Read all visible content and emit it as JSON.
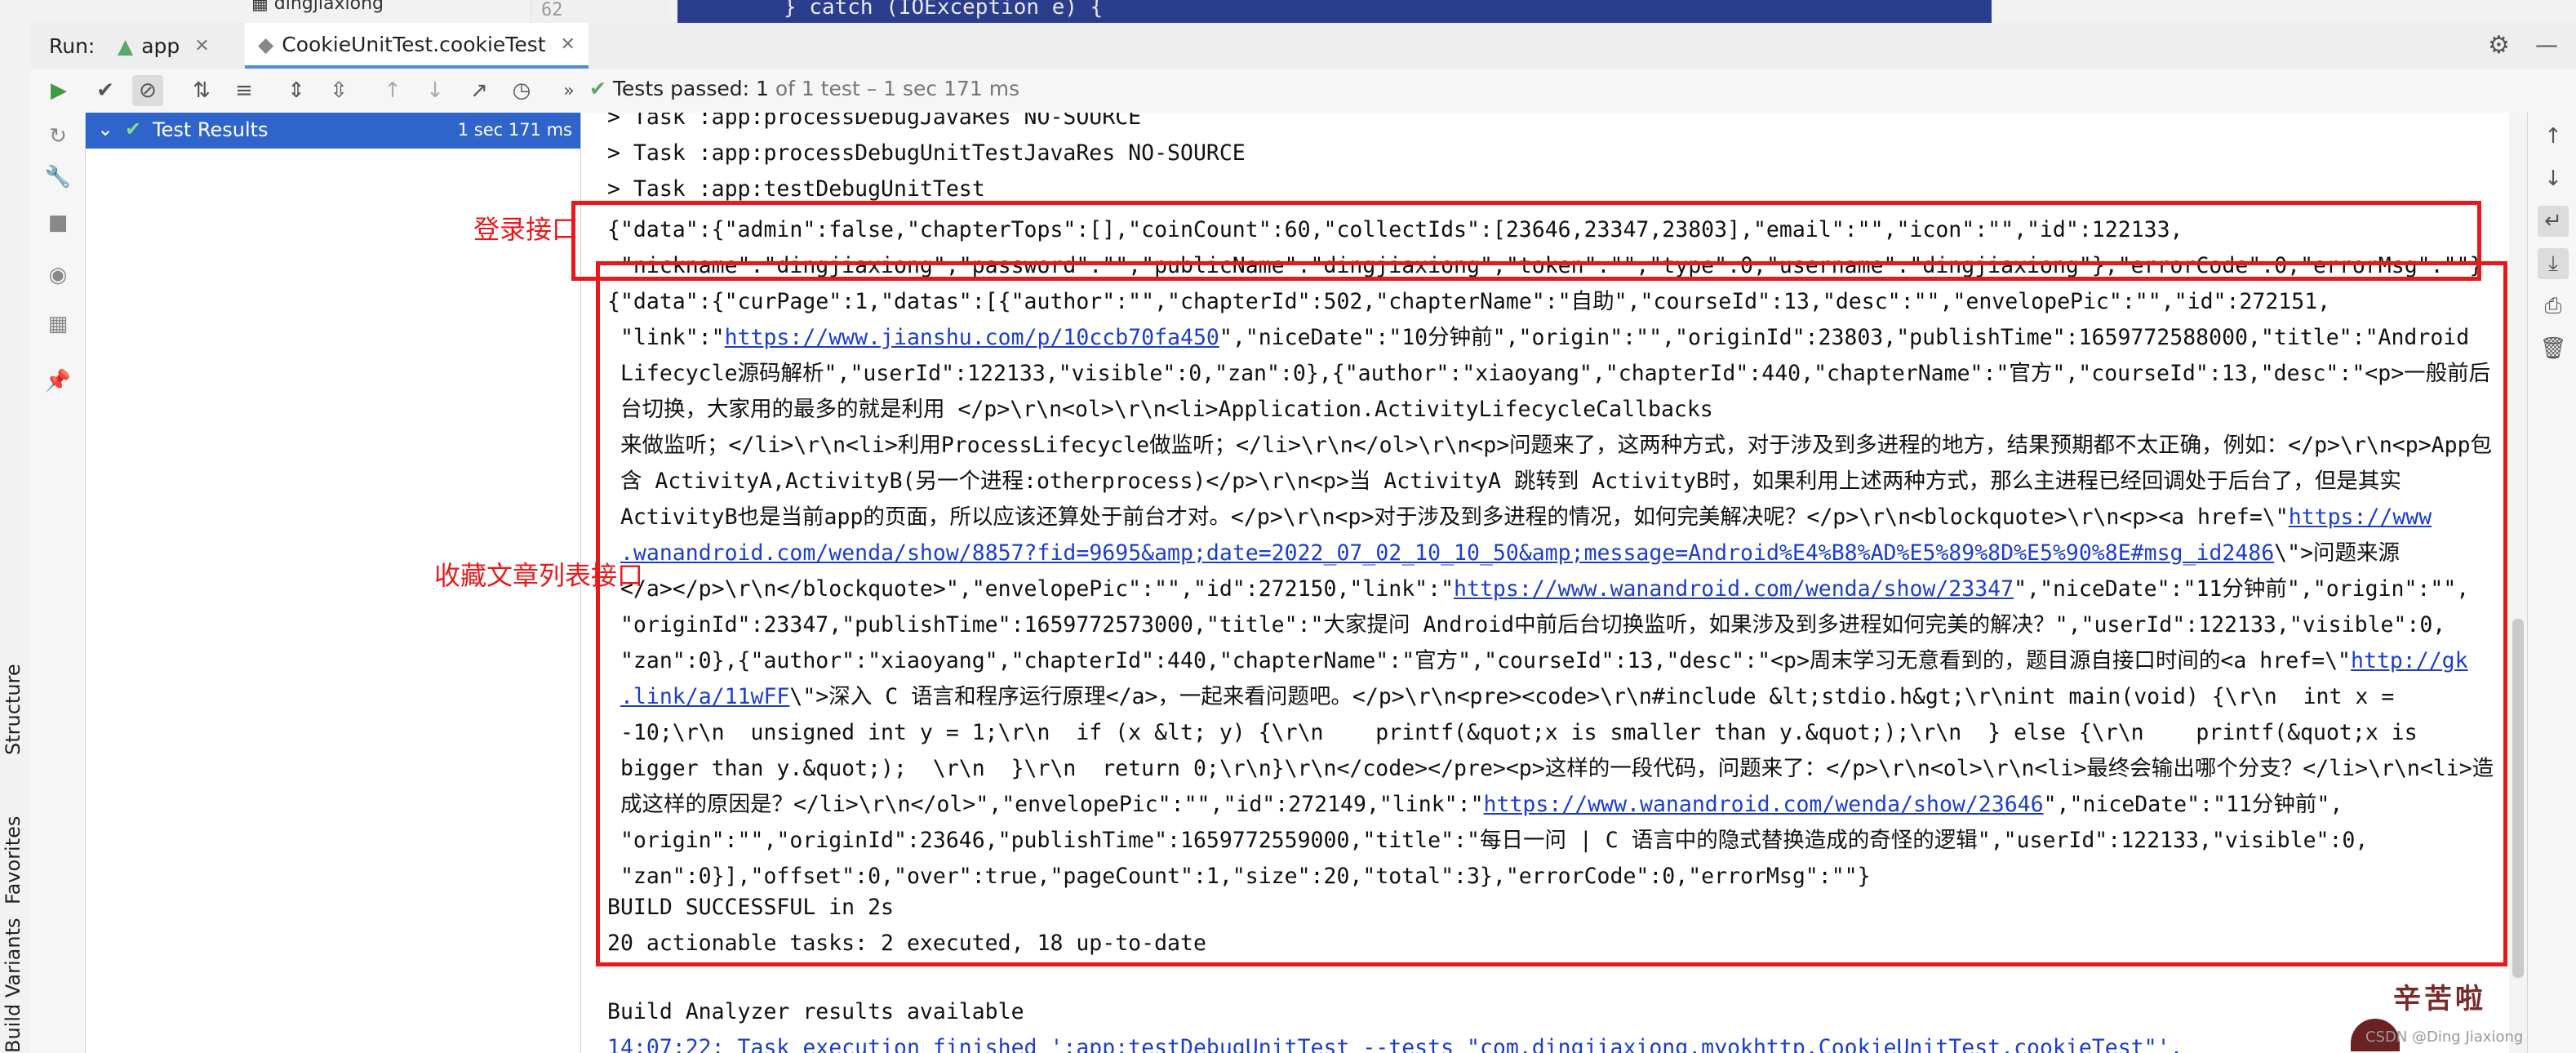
{
  "top_strip": {
    "tree_fragment": "dingjiaxiong",
    "gutter_line": "62",
    "code_fragment": "} catch (IOException e) {"
  },
  "run_bar": {
    "run_label": "Run:",
    "tabs": [
      {
        "label": "app"
      },
      {
        "label": "CookieUnitTest.cookieTest"
      }
    ]
  },
  "toolbar": {
    "status_label": "Tests passed:",
    "status_count": "1",
    "status_detail": "of 1 test – 1 sec 171 ms"
  },
  "tree": {
    "root_label": "Test Results",
    "root_time": "1 sec 171 ms"
  },
  "left_vertical_tabs": [
    "Structure",
    "Favorites",
    "Build Variants"
  ],
  "console": {
    "lines": [
      "> Task :app:processDebugJavaRes NO-SOURCE",
      "> Task :app:processDebugUnitTestJavaRes NO-SOURCE",
      "> Task :app:testDebugUnitTest"
    ],
    "login_json_1": "{\"data\":{\"admin\":false,\"chapterTops\":[],\"coinCount\":60,\"collectIds\":[23646,23347,23803],\"email\":\"\",\"icon\":\"\",\"id\":122133,",
    "login_json_2": " \"nickname\":\"dingjiaxiong\",\"password\":\"\",\"publicName\":\"dingjiaxiong\",\"token\":\"\",\"type\":0,\"username\":\"dingjiaxiong\"},\"errorCode\":0,\"errorMsg\":\"\"}",
    "collect_lines": [
      [
        {
          "t": "{\"data\":{\"curPage\":1,\"datas\":[{\"author\":\"\",\"chapterId\":502,\"chapterName\":\"自助\",\"courseId\":13,\"desc\":\"\",\"envelopePic\":\"\",\"id\":272151,"
        }
      ],
      [
        {
          "t": " \"link\":\""
        },
        {
          "t": "https://www.jianshu.com/p/10ccb70fa450",
          "link": true
        },
        {
          "t": "\",\"niceDate\":\"10分钟前\",\"origin\":\"\",\"originId\":23803,\"publishTime\":1659772588000,\"title\":\"Android"
        }
      ],
      [
        {
          "t": " Lifecycle源码解析\",\"userId\":122133,\"visible\":0,\"zan\":0},{\"author\":\"xiaoyang\",\"chapterId\":440,\"chapterName\":\"官方\",\"courseId\":13,\"desc\":\"<p>一般前后"
        }
      ],
      [
        {
          "t": " 台切换，大家用的最多的就是利用 </p>\\r\\n<ol>\\r\\n<li>Application.ActivityLifecycleCallbacks"
        }
      ],
      [
        {
          "t": " 来做监听；</li>\\r\\n<li>利用ProcessLifecycle做监听；</li>\\r\\n</ol>\\r\\n<p>问题来了，这两种方式，对于涉及到多进程的地方，结果预期都不太正确，例如：</p>\\r\\n<p>App包"
        }
      ],
      [
        {
          "t": " 含 ActivityA,ActivityB(另一个进程:otherprocess)</p>\\r\\n<p>当 ActivityA 跳转到 ActivityB时，如果利用上述两种方式，那么主进程已经回调处于后台了，但是其实"
        }
      ],
      [
        {
          "t": " ActivityB也是当前app的页面，所以应该还算处于前台才对。</p>\\r\\n<p>对于涉及到多进程的情况，如何完美解决呢？</p>\\r\\n<blockquote>\\r\\n<p><a href=\\\""
        },
        {
          "t": "https://www",
          "link": true
        }
      ],
      [
        {
          "t": " ",
          "link": false
        },
        {
          "t": ".wanandroid.com/wenda/show/8857?fid=9695&amp;date=2022_07_02_10_10_50&amp;message=Android%E4%B8%AD%E5%89%8D%E5%90%8E#msg_id2486",
          "link": true
        },
        {
          "t": "\\\">问题来源"
        }
      ],
      [
        {
          "t": " </a></p>\\r\\n</blockquote>\",\"envelopePic\":\"\",\"id\":272150,\"link\":\""
        },
        {
          "t": "https://www.wanandroid.com/wenda/show/23347",
          "link": true
        },
        {
          "t": "\",\"niceDate\":\"11分钟前\",\"origin\":\"\","
        }
      ],
      [
        {
          "t": " \"originId\":23347,\"publishTime\":1659772573000,\"title\":\"大家提问 Android中前后台切换监听，如果涉及到多进程如何完美的解决？\",\"userId\":122133,\"visible\":0,"
        }
      ],
      [
        {
          "t": " \"zan\":0},{\"author\":\"xiaoyang\",\"chapterId\":440,\"chapterName\":\"官方\",\"courseId\":13,\"desc\":\"<p>周末学习无意看到的，题目源自接口时间的<a href=\\\""
        },
        {
          "t": "http://gk",
          "link": true
        }
      ],
      [
        {
          "t": " ",
          "link": false
        },
        {
          "t": ".link/a/11wFF",
          "link": true
        },
        {
          "t": "\\\">深入 C 语言和程序运行原理</a>，一起来看问题吧。</p>\\r\\n<pre><code>\\r\\n#include &lt;stdio.h&gt;\\r\\nint main(void) {\\r\\n  int x ="
        }
      ],
      [
        {
          "t": " -10;\\r\\n  unsigned int y = 1;\\r\\n  if (x &lt; y) {\\r\\n    printf(&quot;x is smaller than y.&quot;);\\r\\n  } else {\\r\\n    printf(&quot;x is"
        }
      ],
      [
        {
          "t": " bigger than y.&quot;);  \\r\\n  }\\r\\n  return 0;\\r\\n}\\r\\n</code></pre><p>这样的一段代码，问题来了：</p>\\r\\n<ol>\\r\\n<li>最终会输出哪个分支？</li>\\r\\n<li>造"
        }
      ],
      [
        {
          "t": " 成这样的原因是？</li>\\r\\n</ol>\",\"envelopePic\":\"\",\"id\":272149,\"link\":\""
        },
        {
          "t": "https://www.wanandroid.com/wenda/show/23646",
          "link": true
        },
        {
          "t": "\",\"niceDate\":\"11分钟前\","
        }
      ],
      [
        {
          "t": " \"origin\":\"\",\"originId\":23646,\"publishTime\":1659772559000,\"title\":\"每日一问 | C 语言中的隐式替换造成的奇怪的逻辑\",\"userId\":122133,\"visible\":0,"
        }
      ],
      [
        {
          "t": " \"zan\":0}],\"offset\":0,\"over\":true,\"pageCount\":1,\"size\":20,\"total\":3},\"errorCode\":0,\"errorMsg\":\"\"}"
        }
      ]
    ],
    "build_success": "BUILD SUCCESSFUL in 2s",
    "actionable": "20 actionable tasks: 2 executed, 18 up-to-date",
    "analyzer": "Build Analyzer results available",
    "last_line": "14:07:22: Task execution finished ':app:testDebugUnitTest --tests \"com.dingjiaxiong.myokhttp.CookieUnitTest.cookieTest\"'."
  },
  "annotations": {
    "login_label": "登录接口",
    "collect_label": "收藏文章列表接口",
    "color": "#e8191b"
  },
  "sticker": {
    "text": "辛苦啦",
    "watermark": "CSDN @Ding Jiaxiong"
  },
  "colors": {
    "selection": "#2f65ca",
    "pass_green": "#59a869",
    "link": "#1d3ec9"
  }
}
